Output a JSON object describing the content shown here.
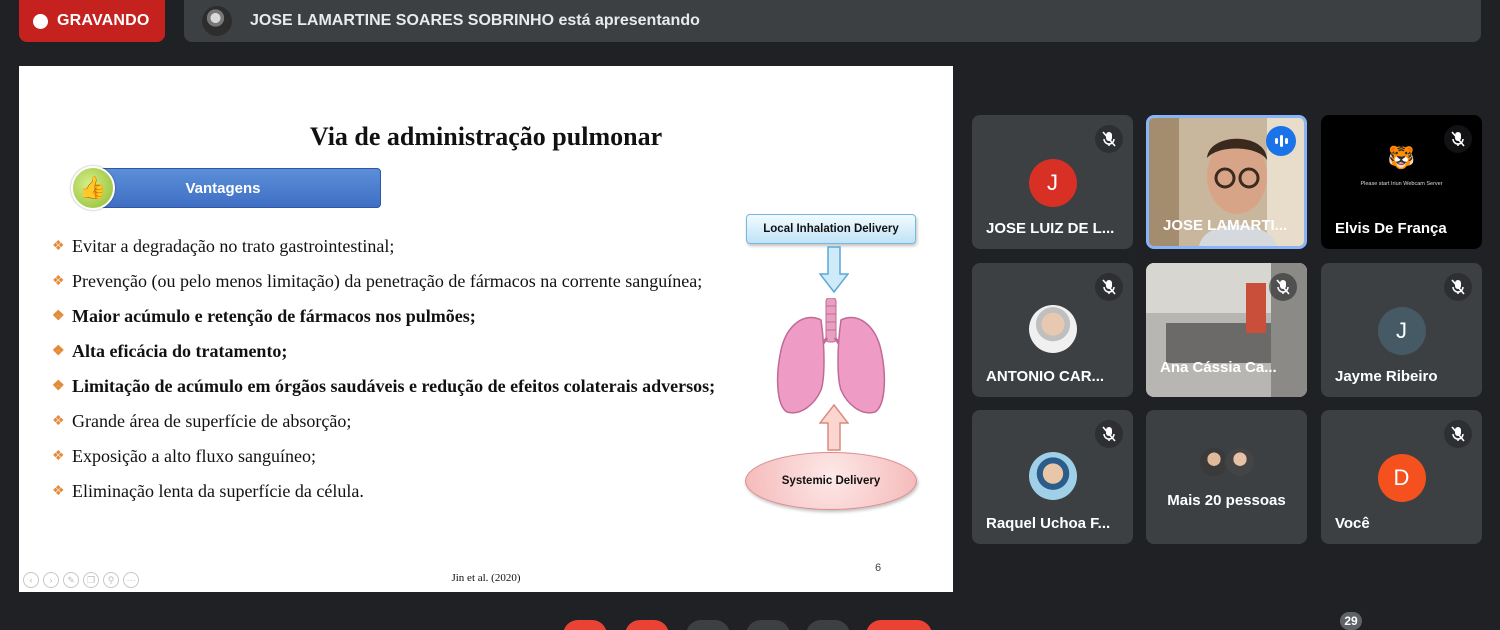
{
  "recording": {
    "label": "GRAVANDO"
  },
  "presenter_bar": {
    "text": "JOSE LAMARTINE SOARES SOBRINHO está apresentando"
  },
  "slide": {
    "title": "Via de administração pulmonar",
    "section_label": "Vantagens",
    "bullets": [
      {
        "text": "Evitar a degradação no trato gastrointestinal;",
        "bold": false
      },
      {
        "text": "Prevenção (ou pelo menos limitação) da penetração de fármacos na corrente sanguínea;",
        "bold": false
      },
      {
        "text": "Maior acúmulo e retenção de fármacos nos pulmões;",
        "bold": true
      },
      {
        "text": "Alta eficácia do tratamento;",
        "bold": true
      },
      {
        "text": "Limitação de acúmulo em órgãos saudáveis e redução de efeitos colaterais adversos;",
        "bold": true
      },
      {
        "text": "Grande área de superfície de absorção;",
        "bold": false
      },
      {
        "text": "Exposição a alto fluxo sanguíneo;",
        "bold": false
      },
      {
        "text": "Eliminação lenta da superfície da célula.",
        "bold": false
      }
    ],
    "diagram": {
      "top_label": "Local Inhalation Delivery",
      "bottom_label": "Systemic Delivery"
    },
    "citation": "Jin et al. (2020)",
    "page_number": "6"
  },
  "participants": [
    {
      "name": "JOSE LUIZ DE L...",
      "avatar_letter": "J",
      "avatar_color": "#d93025",
      "muted": true
    },
    {
      "name": "JOSE LAMARTI...",
      "camera": true,
      "speaking": true
    },
    {
      "name": "Elvis De França",
      "camera": true,
      "muted": true,
      "cam_caption": "Please start Iriun Webcam Server"
    },
    {
      "name": "ANTONIO CAR...",
      "avatar_photo": true,
      "muted": true
    },
    {
      "name": "Ana Cássia Ca...",
      "camera": true,
      "muted": true
    },
    {
      "name": "Jayme Ribeiro",
      "avatar_letter": "J",
      "avatar_color": "#455a64",
      "muted": true
    },
    {
      "name": "Raquel Uchoa F...",
      "avatar_photo": true,
      "muted": true
    },
    {
      "name": "Mais 20 pessoas"
    },
    {
      "name": "Você",
      "avatar_letter": "D",
      "avatar_color": "#f4511e",
      "muted": true
    }
  ],
  "participant_count": "29",
  "colors": {
    "record": "#c5221f",
    "speaking": "#1a73e8",
    "active_border": "#8ab4f8"
  }
}
